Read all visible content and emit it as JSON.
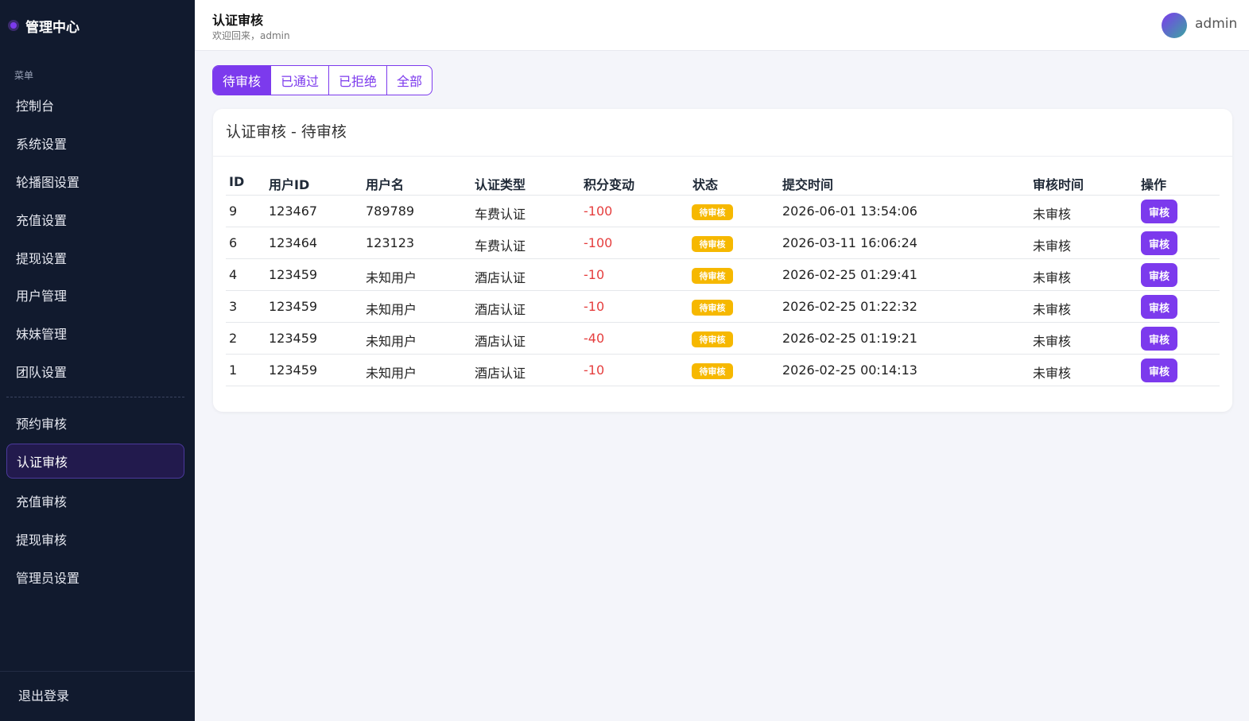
{
  "sidebar": {
    "brand": "管理中心",
    "menu_caption": "菜单",
    "items": [
      {
        "label": "控制台"
      },
      {
        "label": "系统设置"
      },
      {
        "label": "轮播图设置"
      },
      {
        "label": "充值设置"
      },
      {
        "label": "提现设置"
      },
      {
        "label": "用户管理"
      },
      {
        "label": "妹妹管理"
      },
      {
        "label": "团队设置"
      },
      {
        "label": "预约审核"
      },
      {
        "label": "认证审核"
      },
      {
        "label": "充值审核"
      },
      {
        "label": "提现审核"
      },
      {
        "label": "管理员设置"
      }
    ],
    "active_item": "认证审核",
    "logout": "退出登录"
  },
  "header": {
    "title": "认证审核",
    "welcome": "欢迎回来，admin",
    "username": "admin"
  },
  "tabs": [
    {
      "label": "待审核"
    },
    {
      "label": "已通过"
    },
    {
      "label": "已拒绝"
    },
    {
      "label": "全部"
    }
  ],
  "active_tab": "待审核",
  "card": {
    "title": "认证审核 - 待审核"
  },
  "table": {
    "headers": [
      "ID",
      "用户ID",
      "用户名",
      "认证类型",
      "积分变动",
      "状态",
      "提交时间",
      "审核时间",
      "操作"
    ],
    "rows": [
      {
        "id": "9",
        "user_id": "123467",
        "username": "789789",
        "type": "车费认证",
        "delta": "-100",
        "status": "待审核",
        "submitted": "2026-06-01 13:54:06",
        "reviewed": "未审核",
        "action": "审核"
      },
      {
        "id": "6",
        "user_id": "123464",
        "username": "123123",
        "type": "车费认证",
        "delta": "-100",
        "status": "待审核",
        "submitted": "2026-03-11 16:06:24",
        "reviewed": "未审核",
        "action": "审核"
      },
      {
        "id": "4",
        "user_id": "123459",
        "username": "未知用户",
        "type": "酒店认证",
        "delta": "-10",
        "status": "待审核",
        "submitted": "2026-02-25 01:29:41",
        "reviewed": "未审核",
        "action": "审核"
      },
      {
        "id": "3",
        "user_id": "123459",
        "username": "未知用户",
        "type": "酒店认证",
        "delta": "-10",
        "status": "待审核",
        "submitted": "2026-02-25 01:22:32",
        "reviewed": "未审核",
        "action": "审核"
      },
      {
        "id": "2",
        "user_id": "123459",
        "username": "未知用户",
        "type": "酒店认证",
        "delta": "-40",
        "status": "待审核",
        "submitted": "2026-02-25 01:19:21",
        "reviewed": "未审核",
        "action": "审核"
      },
      {
        "id": "1",
        "user_id": "123459",
        "username": "未知用户",
        "type": "酒店认证",
        "delta": "-10",
        "status": "待审核",
        "submitted": "2026-02-25 00:14:13",
        "reviewed": "未审核",
        "action": "审核"
      }
    ]
  },
  "colors": {
    "accent": "#7c3aed",
    "sidebar_bg": "#111a2e",
    "badge_pending": "#f6b800",
    "negative": "#e53e3e"
  }
}
